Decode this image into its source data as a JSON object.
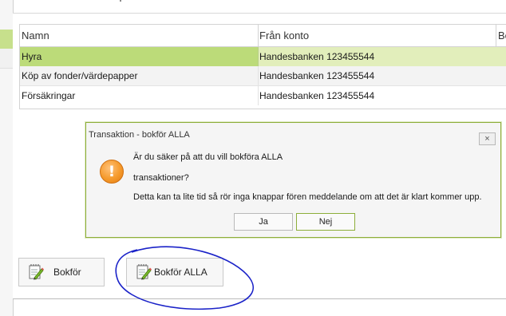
{
  "grid": {
    "columns": [
      "Namn",
      "Från konto",
      "Be"
    ],
    "rows": [
      {
        "namn": "Hyra",
        "fran_konto": "Handesbanken 123455544",
        "selected": true
      },
      {
        "namn": "Köp av fonder/värdepapper",
        "fran_konto": "Handesbanken 123455544"
      },
      {
        "namn": "Försäkringar",
        "fran_konto": "Handesbanken 123455544"
      }
    ]
  },
  "dialog": {
    "title": "Transaktion - bokför ALLA",
    "close_label": "×",
    "icon": "warning-icon",
    "icon_glyph": "!",
    "message_line1": "Är du säker på att du vill bokföra ALLA",
    "message_line2": "transaktioner?",
    "message_line3": "Detta kan ta lite tid så rör inga knappar fören meddelande om att det är klart kommer upp.",
    "buttons": {
      "yes": "Ja",
      "no": "Nej"
    }
  },
  "actions": {
    "bokfor_label": "Bokför",
    "bokfor_alla_label": "Bokför ALLA",
    "icon": "notepad-pencil-icon"
  },
  "colors": {
    "selection": "#bcdb79",
    "accent_border": "#8dae3a",
    "warning": "#f59a2c",
    "annotation": "#1a22c8"
  }
}
